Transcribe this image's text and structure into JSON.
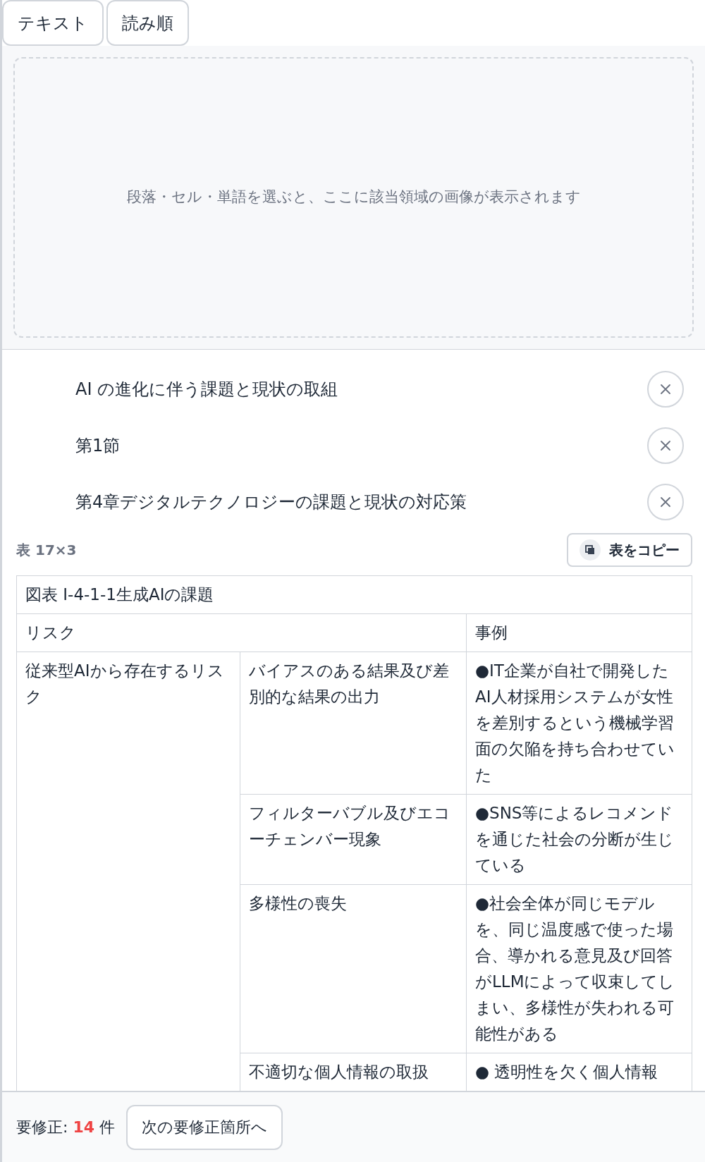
{
  "tabs": [
    {
      "label": "テキスト"
    },
    {
      "label": "読み順"
    }
  ],
  "preview": {
    "empty_message": "段落・セル・単語を選ぶと、ここに該当領域の画像が表示されます"
  },
  "headings": [
    {
      "text": "AI の進化に伴う課題と現状の取組"
    },
    {
      "text": "第1節"
    },
    {
      "text": "第4章デジタルテクノロジーの課題と現状の対応策"
    }
  ],
  "table": {
    "size_label": "表 17×3",
    "copy_button": "表をコピー",
    "caption": "図表 I-4-1-1生成AIの課題",
    "header": [
      "リスク",
      "事例"
    ],
    "groups": [
      {
        "label": "従来型AIから存在するリスク",
        "rows": [
          {
            "risk": "バイアスのある結果及び差別的な結果の出力",
            "example": "●IT企業が自社で開発したAI人材採用システムが女性を差別するという機械学習面の欠陥を持ち合わせていた"
          },
          {
            "risk": "フィルターバブル及びエコーチェンバー現象",
            "example": "●SNS等によるレコメンドを通じた社会の分断が生じている"
          },
          {
            "risk": "多様性の喪失",
            "example": "●社会全体が同じモデルを、同じ温度感で使った場合、導かれる意見及び回答がLLMによって収束してしまい、多様性が失われる可能性がある"
          },
          {
            "risk": "不適切な個人情報の取扱",
            "example": "● 透明性を欠く個人情報"
          }
        ]
      }
    ]
  },
  "footer": {
    "label": "要修正:",
    "count": "14",
    "unit": "件",
    "next_button": "次の要修正箇所へ"
  }
}
